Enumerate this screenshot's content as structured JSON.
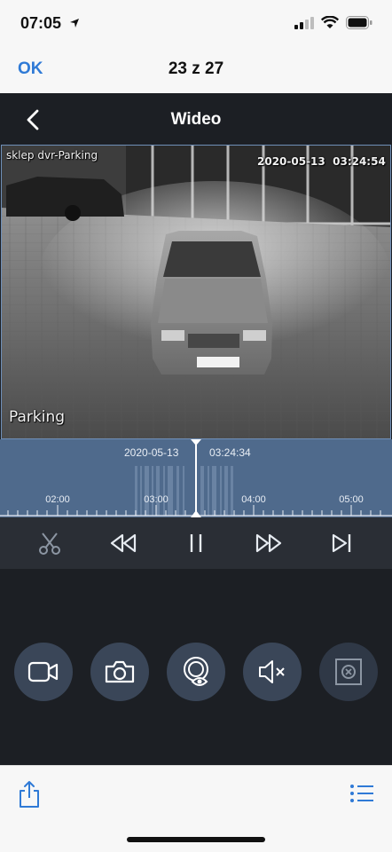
{
  "status_bar": {
    "time": "07:05"
  },
  "photos_nav": {
    "ok_label": "OK",
    "counter": "23 z 27"
  },
  "app": {
    "title": "Wideo"
  },
  "video": {
    "camera_name": "sklep dvr-Parking",
    "timestamp": "2020-05-13  03:24:54",
    "channel_label": "Parking"
  },
  "timeline": {
    "date": "2020-05-13",
    "time": "03:24:34",
    "labels": [
      "02:00",
      "03:00",
      "04:00",
      "05:00"
    ]
  },
  "controls": {
    "items": [
      "clip",
      "rewind",
      "pause",
      "fast-forward",
      "next-frame"
    ]
  },
  "actions": {
    "items": [
      "record",
      "snapshot",
      "eye-tracking",
      "mute",
      "zoom"
    ]
  },
  "colors": {
    "accent": "#2f7ad6",
    "app_bg": "#1c1f24",
    "timeline_bg": "#4f6a8c",
    "button_bg": "#3a4658"
  }
}
